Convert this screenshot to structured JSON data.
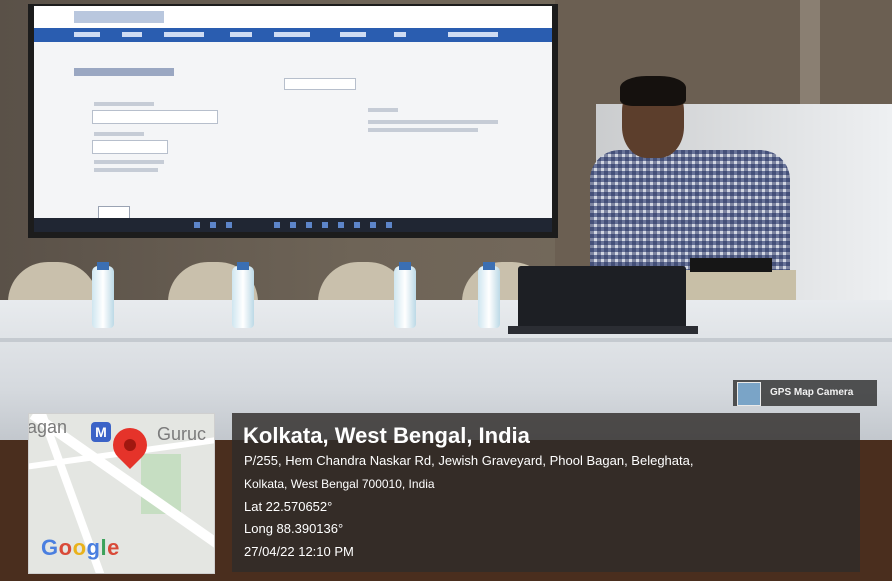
{
  "gps_badge": {
    "label": "GPS Map Camera"
  },
  "map": {
    "label_left": "agan",
    "label_right": "Guruc",
    "metro_letter": "M",
    "brand": [
      "G",
      "o",
      "o",
      "g",
      "l",
      "e"
    ],
    "pin_color": "#e5332a"
  },
  "location": {
    "city": "Kolkata, West Bengal, India",
    "address_line1": "P/255, Hem Chandra Naskar Rd, Jewish Graveyard, Phool Bagan, Beleghata,",
    "address_line2": "Kolkata, West Bengal 700010, India",
    "lat": "Lat 22.570652°",
    "long": "Long 88.390136°",
    "datetime": "27/04/22 12:10 PM"
  }
}
